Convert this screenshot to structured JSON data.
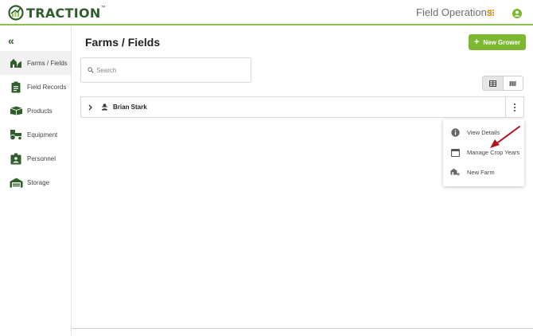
{
  "header": {
    "logo_text": "TRACTION",
    "logo_tm": "™",
    "app_name": "Field Operations",
    "icons": {
      "apps": "apps-grid-icon",
      "user": "user-account-icon"
    }
  },
  "colors": {
    "brand_dark": "#2f5e2a",
    "brand_green": "#7cb82f",
    "accent_line": "#8bc34a",
    "apps_orange": "#f0a21c",
    "annotation_red": "#b3151c"
  },
  "sidebar": {
    "collapse_glyph": "«",
    "items": [
      {
        "label": "Farms / Fields",
        "icon": "farm-field-icon",
        "active": true
      },
      {
        "label": "Field Records",
        "icon": "clipboard-icon",
        "active": false
      },
      {
        "label": "Products",
        "icon": "products-icon",
        "active": false
      },
      {
        "label": "Equipment",
        "icon": "tractor-icon",
        "active": false
      },
      {
        "label": "Personnel",
        "icon": "personnel-badge-icon",
        "active": false
      },
      {
        "label": "Storage",
        "icon": "storage-warehouse-icon",
        "active": false
      }
    ]
  },
  "main": {
    "title": "Farms / Fields",
    "new_grower_label": "New Grower",
    "new_grower_plus": "+",
    "search": {
      "placeholder": "Search",
      "value": ""
    },
    "view_toggle": [
      {
        "icon": "table-view-icon",
        "active": true
      },
      {
        "icon": "map-view-icon",
        "active": false
      }
    ],
    "growers": [
      {
        "name": "Brian Stark",
        "icon": "grower-person-icon",
        "expanded": false
      }
    ]
  },
  "context_menu": {
    "items": [
      {
        "label": "View Details",
        "icon": "info-icon"
      },
      {
        "label": "Manage Crop Years",
        "icon": "calendar-icon"
      },
      {
        "label": "New Farm",
        "icon": "new-farm-icon"
      }
    ]
  }
}
